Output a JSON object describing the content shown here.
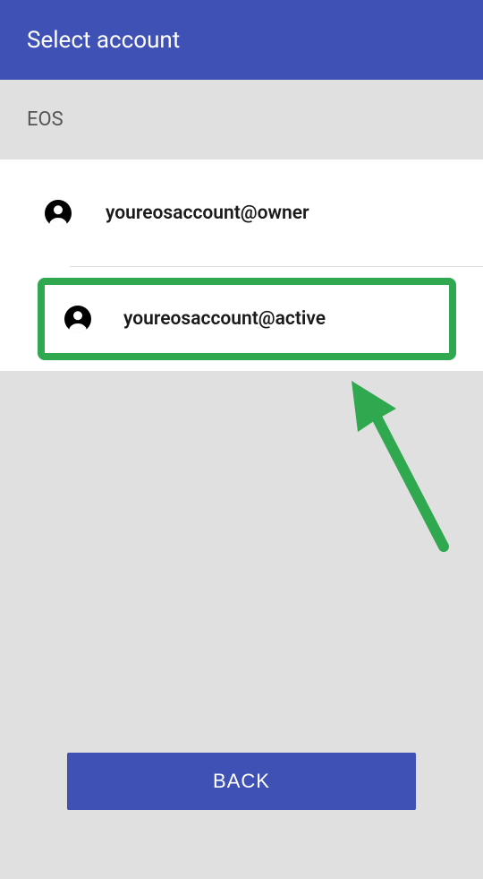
{
  "header": {
    "title": "Select account"
  },
  "section": {
    "label": "EOS"
  },
  "accounts": [
    {
      "label": "youreosaccount@owner",
      "selected": false
    },
    {
      "label": "youreosaccount@active",
      "selected": true
    }
  ],
  "buttons": {
    "back": "BACK"
  },
  "colors": {
    "primary": "#3f51b5",
    "highlight": "#2fa84f"
  }
}
